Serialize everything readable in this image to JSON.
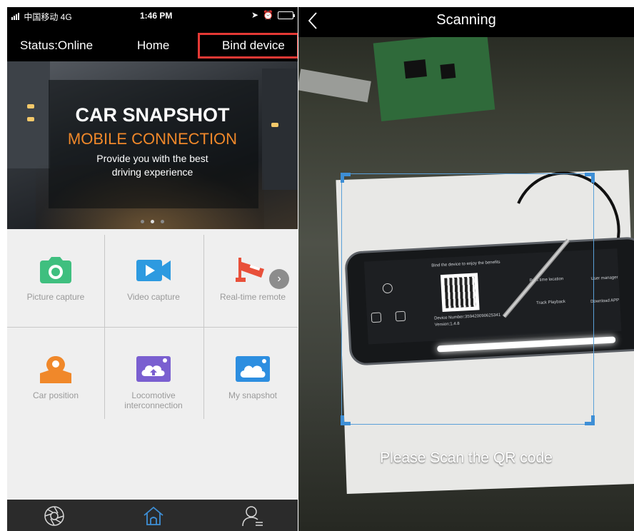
{
  "left": {
    "status_bar": {
      "carrier": "中国移动 4G",
      "time": "1:46 PM"
    },
    "nav": {
      "status_label": "Status:Online",
      "home_label": "Home",
      "bind_label": "Bind device"
    },
    "banner": {
      "title": "CAR SNAPSHOT",
      "subtitle": "MOBILE  CONNECTION",
      "line1": "Provide you with the best",
      "line2": "driving experience",
      "page_count": 3,
      "active_page": 2
    },
    "grid": [
      {
        "label": "Picture capture",
        "icon": "camera-icon",
        "color": "#3fbf7f"
      },
      {
        "label": "Video capture",
        "icon": "video-camera-icon",
        "color": "#2d9ae0"
      },
      {
        "label": "Real-time remote",
        "icon": "cctv-icon",
        "color": "#e8503a"
      },
      {
        "label": "Car position",
        "icon": "map-pin-icon",
        "color": "#f0882a"
      },
      {
        "label": "Locomotive",
        "label2": "interconnection",
        "icon": "cloud-upload-icon",
        "color": "#7a5fd0"
      },
      {
        "label": "My snapshot",
        "icon": "photo-cloud-icon",
        "color": "#2d8ee0"
      }
    ],
    "tabs": [
      "aperture-icon",
      "home-icon",
      "user-icon"
    ],
    "highlight_color": "#e53935"
  },
  "right": {
    "title": "Scanning",
    "prompt": "Please Scan the QR code",
    "device_screen": {
      "bind_text": "Bind the device to enjoy the benefits",
      "device_number": "Device Number:359420090625341",
      "version": "Version:1.4.8",
      "real_time_location": "Real time location",
      "track_playback": "Track Playback",
      "user_manager": "User manager",
      "download_app": "Download APP"
    },
    "frame_color": "#3e8fd6"
  }
}
